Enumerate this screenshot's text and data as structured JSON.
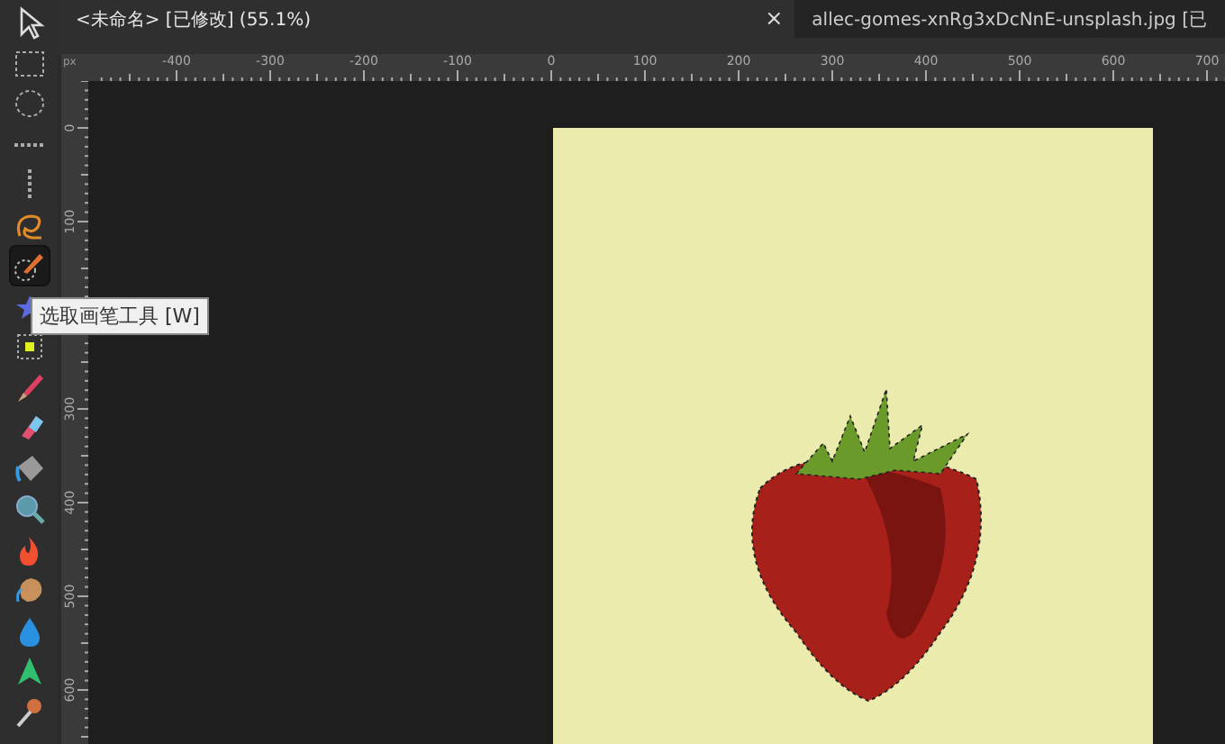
{
  "tabs": [
    {
      "label": "<未命名> [已修改] (55.1%)",
      "selected": true,
      "close": "×"
    },
    {
      "label": "allec-gomes-xnRg3xDcNnE-unsplash.jpg [已",
      "selected": false
    }
  ],
  "tools": [
    {
      "kind": "pointer",
      "selected": false
    },
    {
      "kind": "rect-marquee",
      "selected": false
    },
    {
      "kind": "ellipse-marquee",
      "selected": false
    },
    {
      "kind": "row-marquee",
      "selected": false
    },
    {
      "kind": "column-marquee",
      "selected": false
    },
    {
      "kind": "lasso",
      "selected": false
    },
    {
      "kind": "selection-brush",
      "selected": true
    },
    {
      "kind": "star",
      "selected": false
    },
    {
      "kind": "pixel",
      "selected": false
    },
    {
      "kind": "brush",
      "selected": false
    },
    {
      "kind": "eraser",
      "selected": false
    },
    {
      "kind": "fill",
      "selected": false
    },
    {
      "kind": "zoom",
      "selected": false
    },
    {
      "kind": "flame",
      "selected": false
    },
    {
      "kind": "smudge",
      "selected": false
    },
    {
      "kind": "drop",
      "selected": false
    },
    {
      "kind": "sharpen",
      "selected": false
    },
    {
      "kind": "dodge",
      "selected": false
    }
  ],
  "tooltip": "选取画笔工具 [W]",
  "ruler": {
    "unit": "px",
    "horizontal_labels": [
      "-400",
      "-300",
      "-200",
      "-100",
      "0",
      "100",
      "200",
      "300",
      "400",
      "500",
      "600",
      "700"
    ],
    "vertical_labels_upper": [
      "0",
      "100"
    ],
    "vertical_labels_lower": [
      "300",
      "400",
      "500",
      "600"
    ]
  }
}
